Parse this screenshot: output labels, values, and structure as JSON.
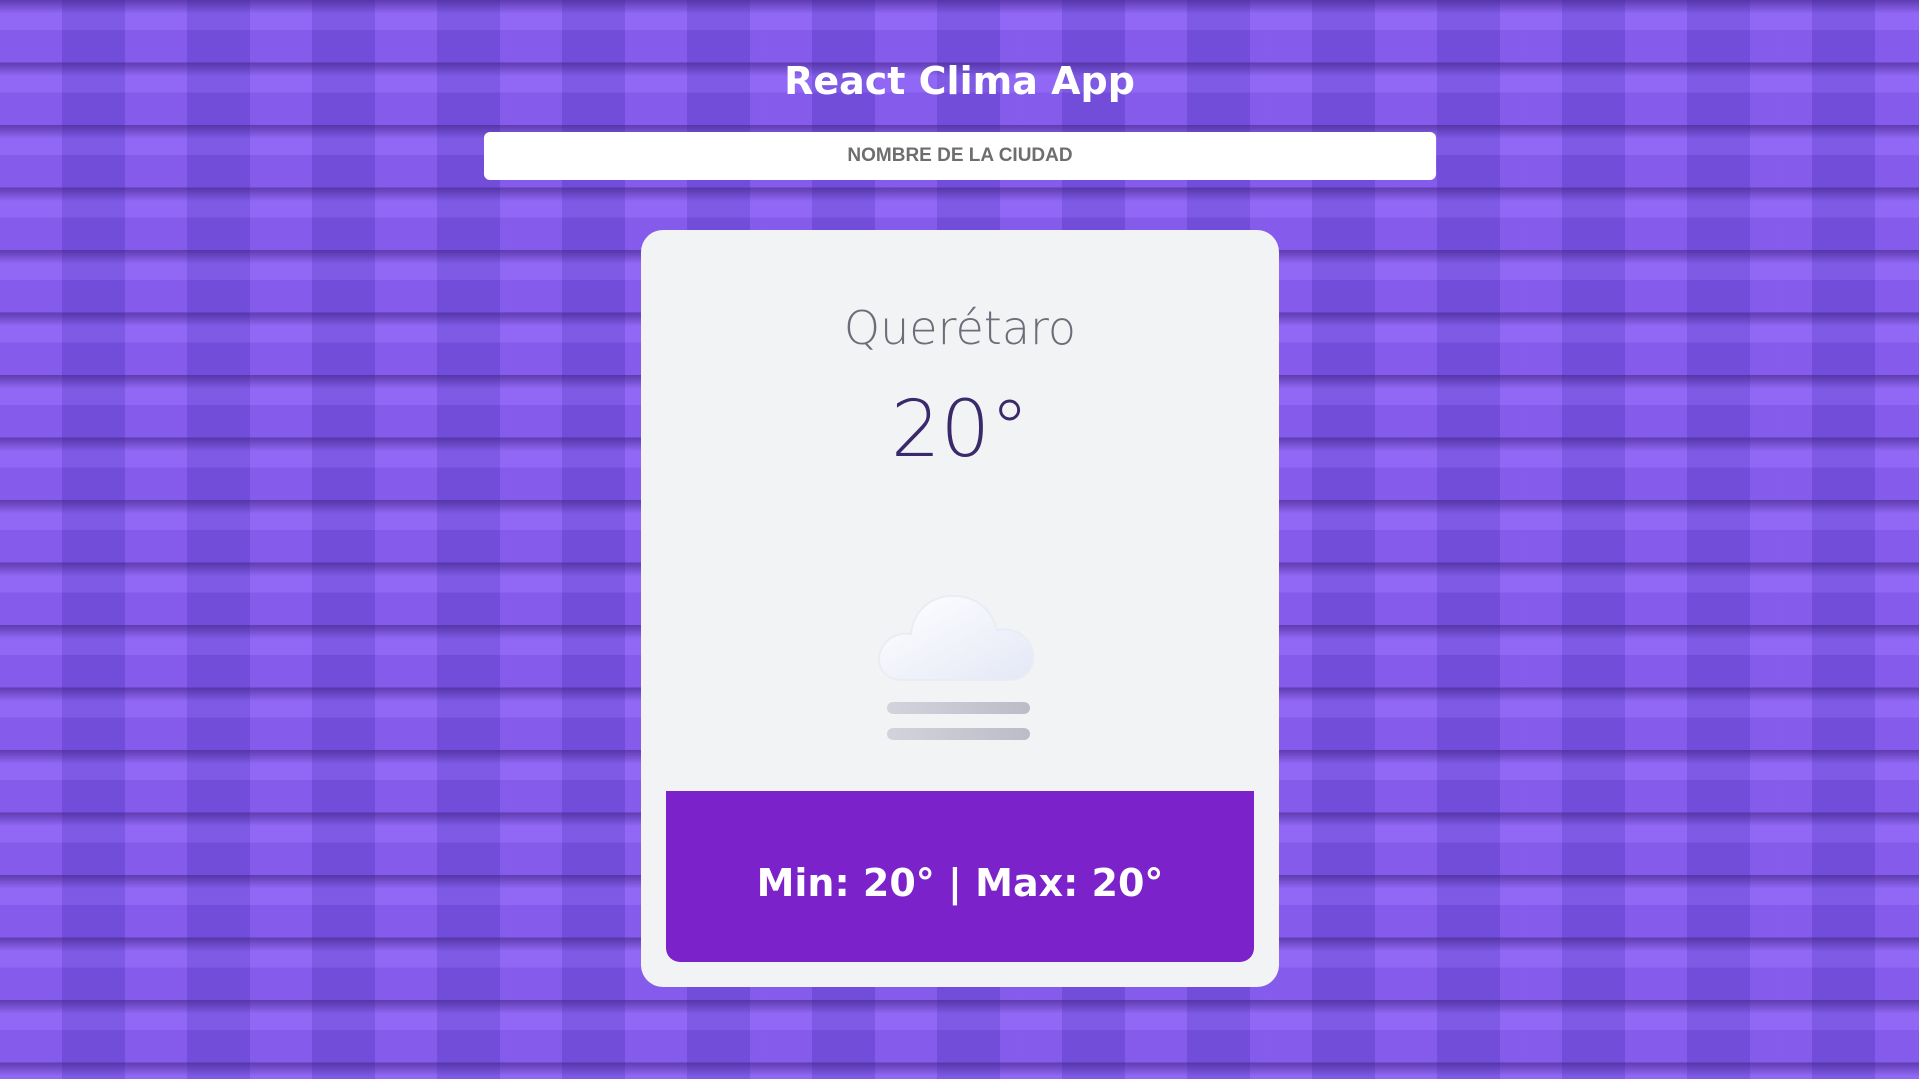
{
  "app": {
    "title": "React Clima App"
  },
  "search": {
    "placeholder": "NOMBRE DE LA CIUDAD",
    "value": ""
  },
  "weather": {
    "city": "Querétaro",
    "temperature": "20°",
    "icon": "fog-icon",
    "min_label": "Min:",
    "min_value": "20°",
    "separator": "|",
    "max_label": "Max:",
    "max_value": "20°",
    "minmax_text": "Min: 20° | Max: 20°"
  },
  "colors": {
    "background": "#7c55e6",
    "card": "#f2f3f5",
    "minmax_panel": "#7b22cb",
    "temperature_text": "#3b2a6b",
    "city_text": "#6d6d7a"
  }
}
